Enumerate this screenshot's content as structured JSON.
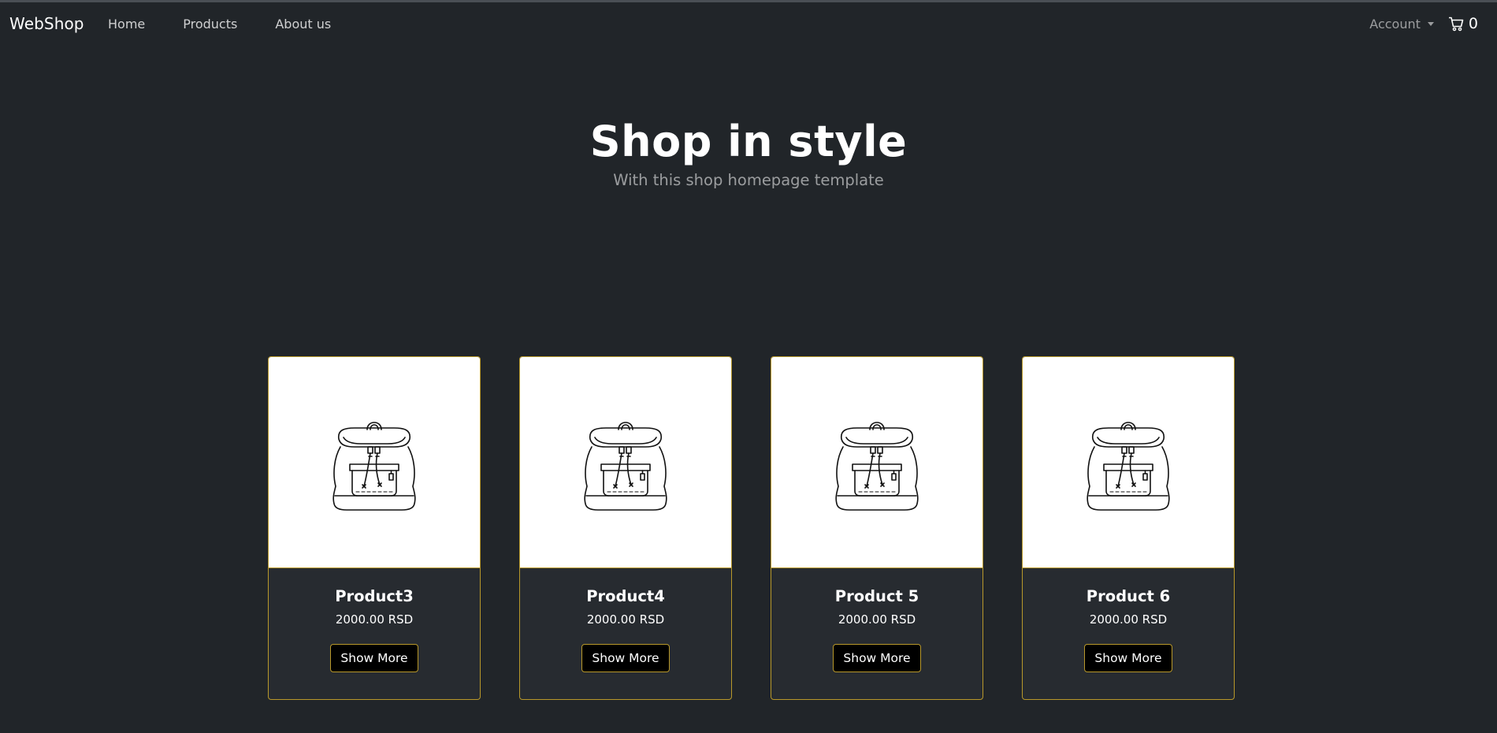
{
  "nav": {
    "brand": "WebShop",
    "links": [
      "Home",
      "Products",
      "About us"
    ],
    "account": "Account",
    "cart_count": "0"
  },
  "hero": {
    "title": "Shop in style",
    "subtitle": "With this shop homepage template"
  },
  "products": [
    {
      "name": "Product3",
      "price": "2000.00 RSD",
      "button": "Show More",
      "image_icon": "backpack-icon"
    },
    {
      "name": "Product4",
      "price": "2000.00 RSD",
      "button": "Show More",
      "image_icon": "backpack-icon"
    },
    {
      "name": "Product 5",
      "price": "2000.00 RSD",
      "button": "Show More",
      "image_icon": "backpack-icon"
    },
    {
      "name": "Product 6",
      "price": "2000.00 RSD",
      "button": "Show More",
      "image_icon": "backpack-icon"
    }
  ],
  "colors": {
    "background": "#212529",
    "card_border": "#b8982a",
    "button_bg": "#000000"
  }
}
